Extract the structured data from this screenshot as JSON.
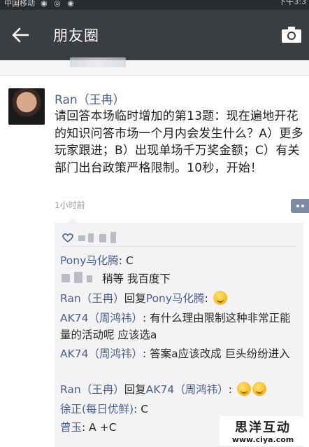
{
  "status_bar": {
    "carrier": "中国移动",
    "time": "下午3:3"
  },
  "header": {
    "title": "朋友圈",
    "back_icon": "back-arrow-icon",
    "camera_icon": "camera-icon"
  },
  "post": {
    "author": "Ran（王冉）",
    "text": "请回答本场临时增加的第13题：现在遍地开花的知识问答市场一个月内会发生什么？A）更多玩家跟进；B）出现单场千万奖金额；C）有关部门出台政策严格限制。10秒，开始！",
    "time": "1小时前"
  },
  "comments": [
    {
      "name": "Pony马化腾",
      "sep": ": ",
      "text": "C",
      "reply_to": ""
    },
    {
      "name": "",
      "sep": "",
      "text": "稍等 我百度下",
      "reply_to": ""
    },
    {
      "name": "Ran（王冉）",
      "sep": "回复",
      "reply_to": "Pony马化腾",
      "text": ": "
    },
    {
      "name": "AK74（周鸿祎）",
      "sep": ": ",
      "text": "有什么理由限制这种非常正能量的活动呢 应该选a",
      "reply_to": ""
    },
    {
      "name": "AK74（周鸿祎）",
      "sep": ": ",
      "text": "答案a应该改成 巨头纷纷进入",
      "reply_to": ""
    },
    {
      "name": "Ran（王冉）",
      "sep": "回复",
      "reply_to": "AK74（周鸿祎）",
      "text": ": "
    },
    {
      "name": "徐正(每日优鲜)",
      "sep": ": ",
      "text": "C",
      "reply_to": ""
    },
    {
      "name": "曾玉",
      "sep": ": ",
      "text": "A +C",
      "reply_to": ""
    }
  ],
  "watermark": {
    "cn": "思洋互动",
    "url": "www.ciya.com"
  }
}
